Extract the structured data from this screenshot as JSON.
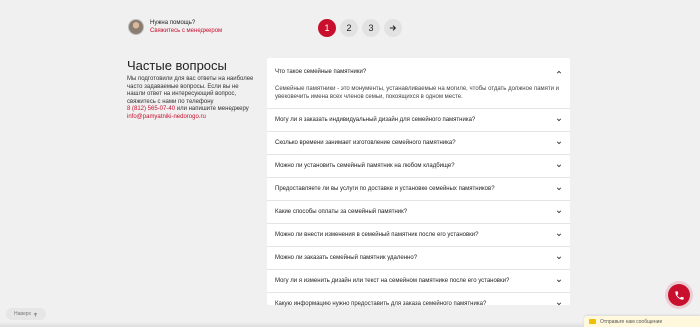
{
  "help": {
    "title": "Нужна помощь?",
    "link": "Свяжитесь с менеджером"
  },
  "pager": {
    "pages": [
      "1",
      "2",
      "3"
    ],
    "active": "1"
  },
  "faq": {
    "title": "Частые вопросы",
    "desc": "Мы подготовили для вас ответы на наиболее часто задаваемые вопросы. Если вы не нашли ответ на интересующий вопрос, свяжитесь с нами по телефону",
    "phone": "8 (812) 565-07-40",
    "or_text": " или напишите менеджеру",
    "email": "info@pamyatniki-nedorogo.ru",
    "items": [
      {
        "q": "Что такое семейные памятники?",
        "a": "Семейные памятники - это монументы, устанавливаемые на могиле, чтобы отдать должное памяти и увековечить имена всех членов семьи, покоящихся в одном месте."
      },
      {
        "q": "Могу ли я заказать индивидуальный дизайн для семейного памятника?"
      },
      {
        "q": "Сколько времени занимает изготовление семейного памятника?"
      },
      {
        "q": "Можно ли установить семейный памятник на любом кладбище?"
      },
      {
        "q": "Предоставляете ли вы услуги по доставке и установке семейных памятников?"
      },
      {
        "q": "Какие способы оплаты за семейный памятник?"
      },
      {
        "q": "Можно ли внести изменения в семейный памятник после его установки?"
      },
      {
        "q": "Можно ли заказать семейный памятник удаленно?"
      },
      {
        "q": "Могу ли я изменить дизайн или текст на семейном памятнике после его установки?"
      },
      {
        "q": "Какую информацию нужно предоставить для заказа семейного памятника?"
      }
    ]
  },
  "back": {
    "label": "Наверх"
  },
  "chat": {
    "label": "Отправьте нам сообщение"
  },
  "colors": {
    "accent": "#c8102e",
    "background": "#f0f0f0"
  }
}
